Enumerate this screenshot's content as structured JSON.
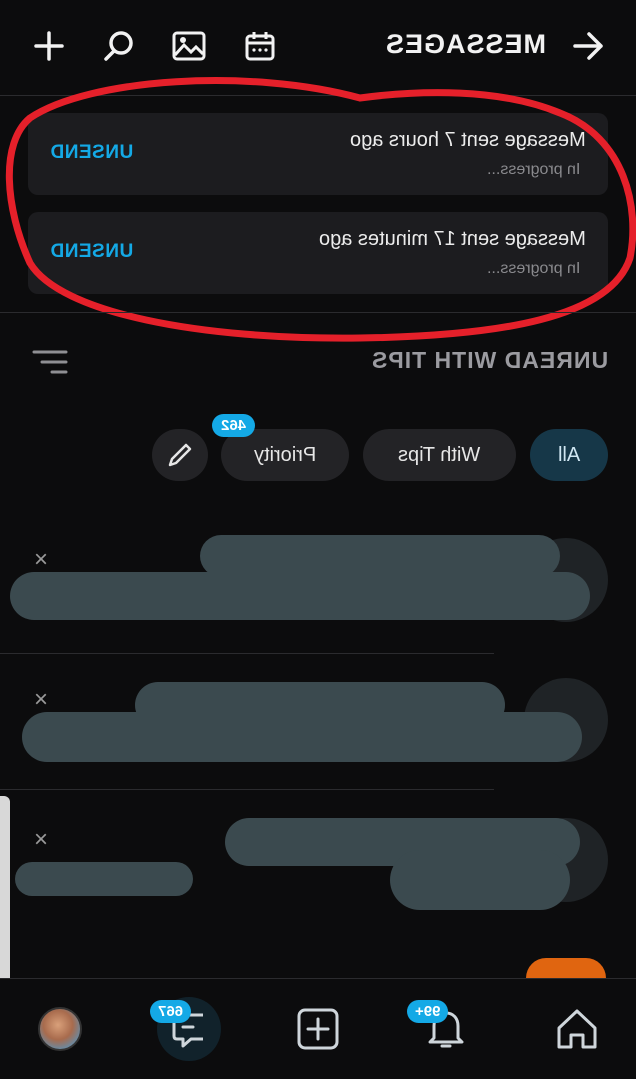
{
  "header": {
    "title": "MESSAGES",
    "icons": [
      "back-arrow-icon",
      "calendar-icon",
      "image-icon",
      "search-icon",
      "plus-icon"
    ]
  },
  "pending_messages": [
    {
      "text": "Message sent 7 hours ago",
      "status": "In progress...",
      "action": "UNSEND"
    },
    {
      "text": "Message sent 17 minutes ago",
      "status": "In progress...",
      "action": "UNSEND"
    }
  ],
  "filter": {
    "title": "UNREAD WITH TIPS",
    "chips": [
      {
        "label": "All",
        "active": true
      },
      {
        "label": "With Tips",
        "active": false
      },
      {
        "label": "Priority",
        "active": false,
        "badge": "462"
      }
    ]
  },
  "chat_rows": [
    {
      "close": "×"
    },
    {
      "close": "×"
    },
    {
      "close": "×"
    }
  ],
  "bottom_nav": {
    "items": [
      {
        "icon": "home-icon"
      },
      {
        "icon": "bell-icon",
        "badge": "99+"
      },
      {
        "icon": "add-post-icon"
      },
      {
        "icon": "messages-icon",
        "badge": "667"
      },
      {
        "icon": "profile-avatar"
      }
    ]
  },
  "colors": {
    "accent": "#14a9e6",
    "background": "#0c0c0d",
    "card": "#1c1c1f",
    "annotation": "#e5202a"
  }
}
